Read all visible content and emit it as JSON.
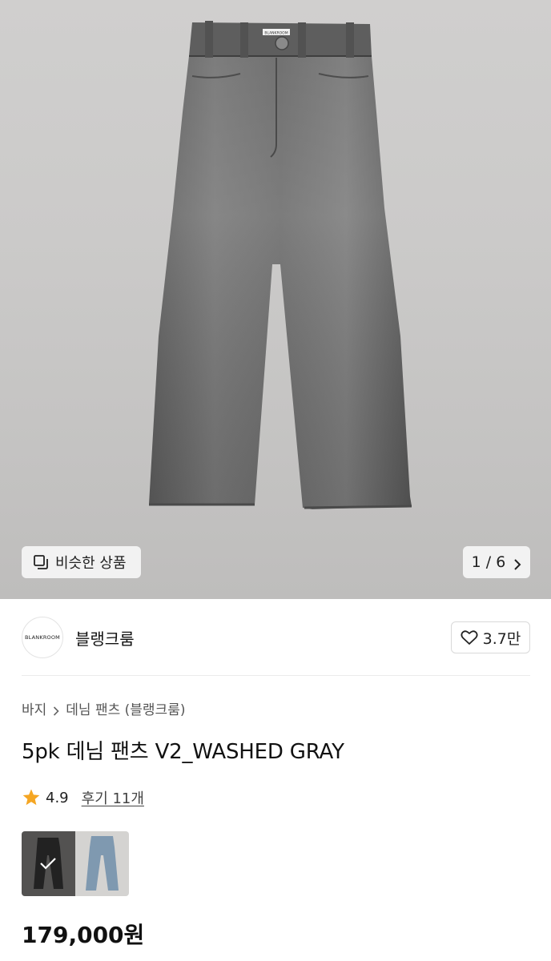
{
  "hero": {
    "similar_label": "비슷한 상품",
    "similar_icon": "similar-items-icon",
    "pager_text": "1 / 6",
    "pager_icon": "chevron-right-icon",
    "waistband_tag": "BLANKROOM"
  },
  "brand": {
    "logo_text": "BLANKROOM",
    "name": "블랭크룸",
    "likes": "3.7만",
    "like_icon": "heart-outline-icon"
  },
  "breadcrumb": {
    "items": [
      "바지",
      "데님 팬츠 (블랭크룸)"
    ],
    "separator_icon": "chevron-right-icon"
  },
  "product": {
    "title": "5pk 데님 팬츠 V2_WASHED GRAY",
    "rating": "4.9",
    "rating_icon": "star-icon",
    "review_label": "후기 11개",
    "price": "179,000원",
    "accent_star": "#f5a623",
    "swatches": [
      {
        "name": "washed-gray",
        "selected": true,
        "check_icon": "checkmark-icon"
      },
      {
        "name": "blue",
        "selected": false
      }
    ]
  }
}
